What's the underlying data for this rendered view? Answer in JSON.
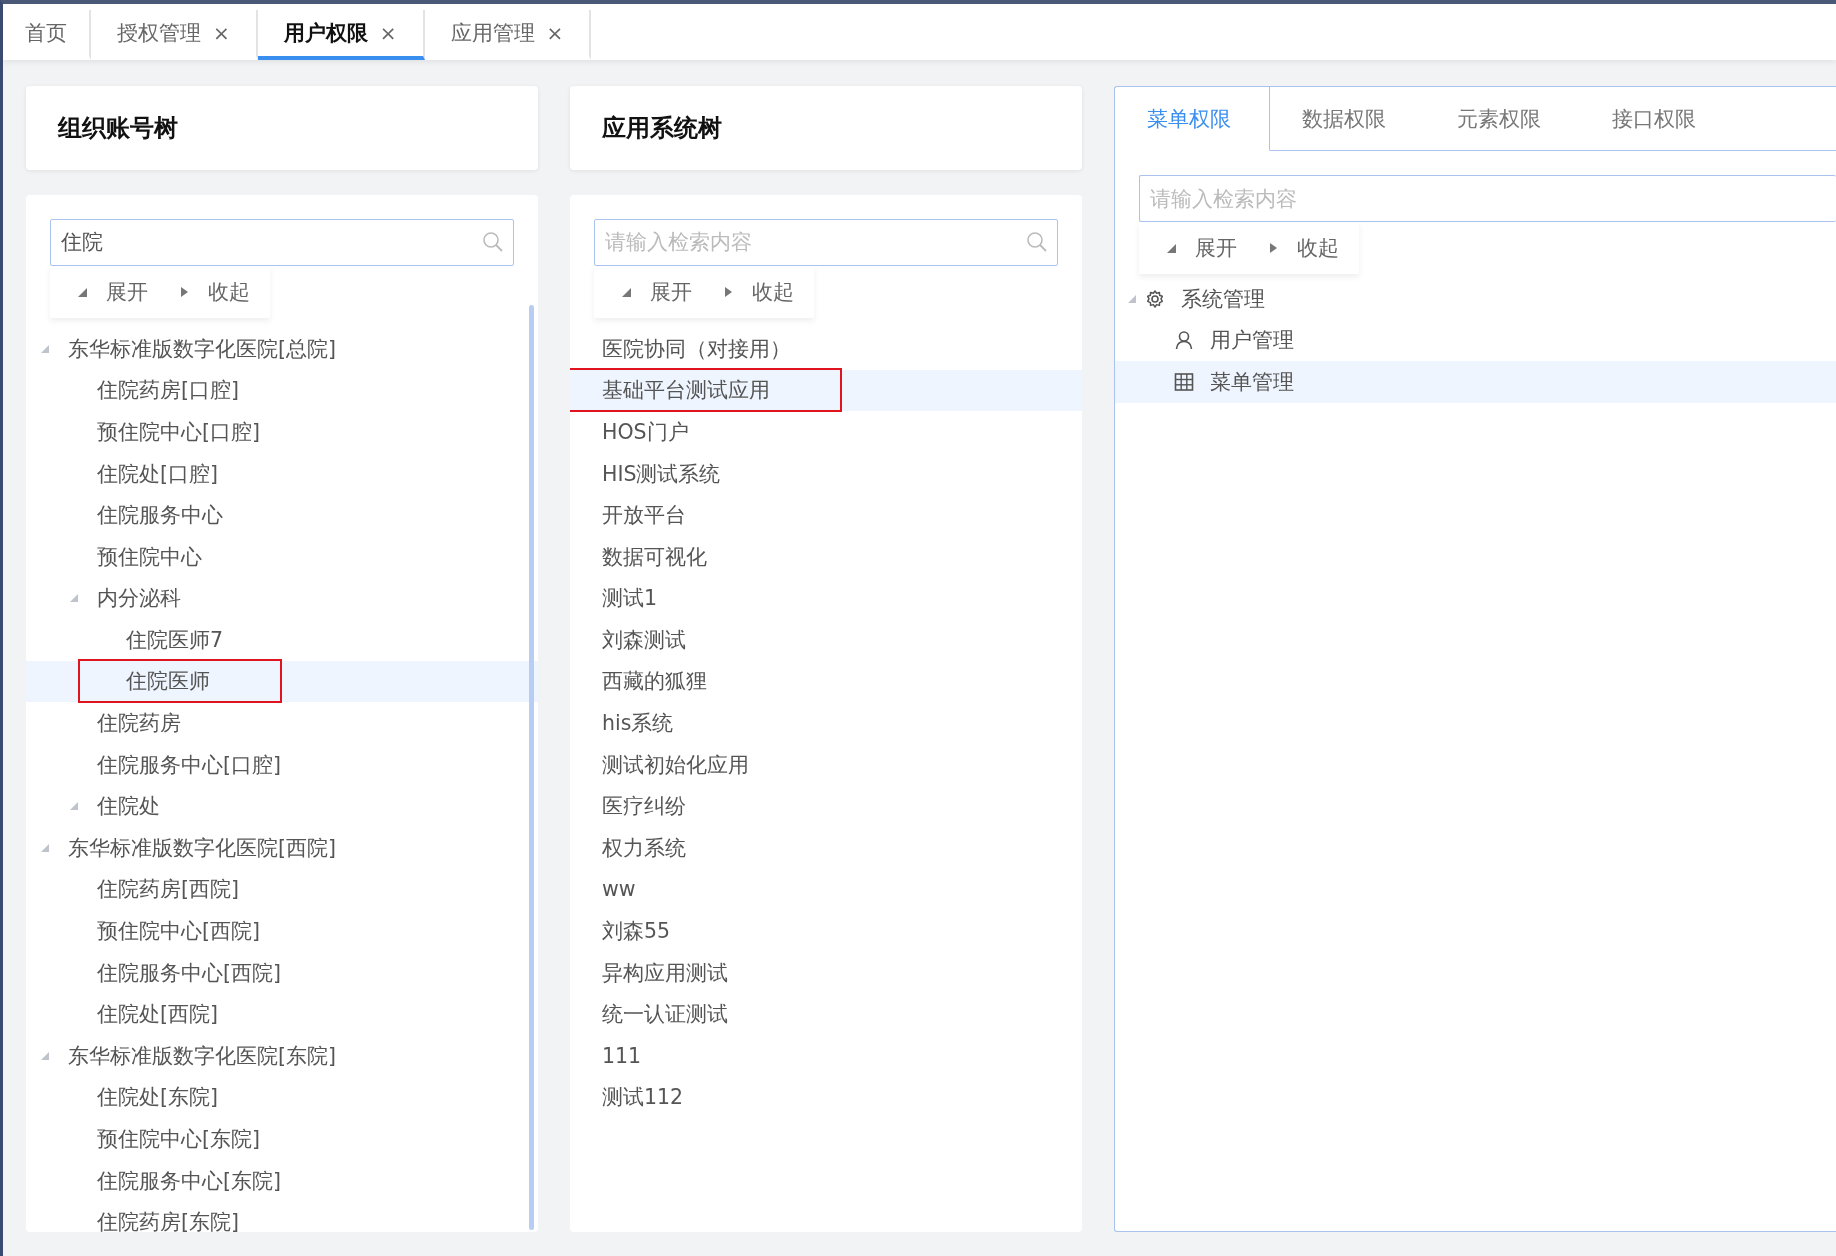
{
  "tabs": [
    {
      "label": "首页",
      "selected": false
    },
    {
      "label": "授权管理",
      "selected": false,
      "close": "×"
    },
    {
      "label": "用户权限",
      "selected": true,
      "close": "×"
    },
    {
      "label": "应用管理",
      "selected": false,
      "close": "×"
    }
  ],
  "org_tree": {
    "title": "组织账号树",
    "search": {
      "value": "住院"
    },
    "expand_label": "展开",
    "collapse_label": "收起",
    "items": [
      {
        "label": "东华标准版数字化医院[总院]",
        "expanded": true,
        "children": [
          {
            "label": "住院药房[口腔]",
            "selected": false
          },
          {
            "label": "预住院中心[口腔]",
            "selected": false
          },
          {
            "label": "住院处[口腔]",
            "selected": false
          },
          {
            "label": "住院服务中心",
            "selected": false
          },
          {
            "label": "预住院中心",
            "selected": false
          },
          {
            "label": "内分泌科",
            "expanded": true,
            "selected": false,
            "children": [
              {
                "label": "住院医师7",
                "selected": false
              },
              {
                "label": "住院医师",
                "selected": true,
                "marked": true
              }
            ]
          },
          {
            "label": "住院药房",
            "selected": false
          },
          {
            "label": "住院服务中心[口腔]",
            "selected": false
          },
          {
            "label": "住院处",
            "expanded": true,
            "selected": false
          }
        ],
        "selected": false
      },
      {
        "label": "东华标准版数字化医院[西院]",
        "expanded": true,
        "selected": false,
        "children": [
          {
            "label": "住院药房[西院]",
            "selected": false
          },
          {
            "label": "预住院中心[西院]",
            "selected": false
          },
          {
            "label": "住院服务中心[西院]",
            "selected": false
          },
          {
            "label": "住院处[西院]",
            "selected": false
          }
        ]
      },
      {
        "label": "东华标准版数字化医院[东院]",
        "expanded": true,
        "selected": false,
        "children": [
          {
            "label": "住院处[东院]",
            "selected": false
          },
          {
            "label": "预住院中心[东院]",
            "selected": false
          },
          {
            "label": "住院服务中心[东院]",
            "selected": false
          },
          {
            "label": "住院药房[东院]",
            "selected": false
          }
        ]
      }
    ]
  },
  "app_tree": {
    "title": "应用系统树",
    "search": {
      "placeholder": "请输入检索内容"
    },
    "expand_label": "展开",
    "collapse_label": "收起",
    "items": [
      {
        "label": "医院协同（对接用）",
        "selected": false
      },
      {
        "label": "基础平台测试应用",
        "selected": true,
        "marked": true
      },
      {
        "label": "HOS门户",
        "selected": false
      },
      {
        "label": "HIS测试系统",
        "selected": false
      },
      {
        "label": "开放平台",
        "selected": false
      },
      {
        "label": "数据可视化",
        "selected": false
      },
      {
        "label": "测试1",
        "selected": false
      },
      {
        "label": "刘森测试",
        "selected": false
      },
      {
        "label": "西藏的狐狸",
        "selected": false
      },
      {
        "label": "his系统",
        "selected": false
      },
      {
        "label": "测试初始化应用",
        "selected": false
      },
      {
        "label": "医疗纠纷",
        "selected": false
      },
      {
        "label": "权力系统",
        "selected": false
      },
      {
        "label": "ww",
        "selected": false
      },
      {
        "label": "刘森55",
        "selected": false
      },
      {
        "label": "异构应用测试",
        "selected": false
      },
      {
        "label": "统一认证测试",
        "selected": false
      },
      {
        "label": "111",
        "selected": false
      },
      {
        "label": "测试112",
        "selected": false
      }
    ]
  },
  "permissions": {
    "tabs": [
      {
        "label": "菜单权限",
        "selected": true
      },
      {
        "label": "数据权限",
        "selected": false
      },
      {
        "label": "元素权限",
        "selected": false
      },
      {
        "label": "接口权限",
        "selected": false
      }
    ],
    "search": {
      "placeholder": "请输入检索内容"
    },
    "expand_label": "展开",
    "collapse_label": "收起",
    "items": [
      {
        "label": "系统管理",
        "kind": "system",
        "expanded": true,
        "selected": false,
        "children": [
          {
            "label": "用户管理",
            "kind": "user",
            "selected": false
          },
          {
            "label": "菜单管理",
            "kind": "menu",
            "selected": true
          }
        ]
      }
    ]
  }
}
